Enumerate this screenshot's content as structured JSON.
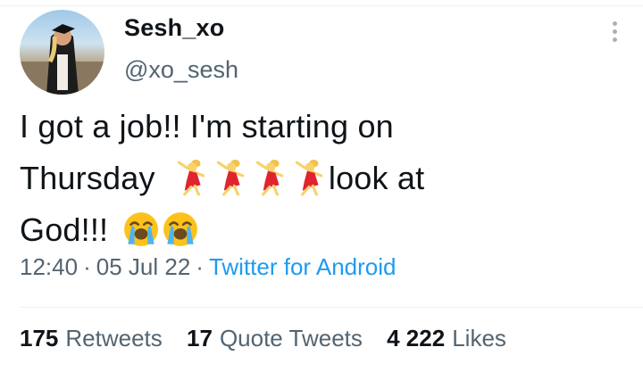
{
  "user": {
    "display_name": "Sesh_xo",
    "handle": "@xo_sesh"
  },
  "tweet": {
    "text_line1": "I got a job!! I'm starting on",
    "text_line2_before": "Thursday",
    "text_line2_after": "look at",
    "text_line3": "God!!!",
    "emojis": [
      "woman-dancing-emoji",
      "loudly-crying-face-emoji"
    ]
  },
  "meta": {
    "time": "12:40",
    "separator": "·",
    "date": "05 Jul 22",
    "source": "Twitter for Android"
  },
  "stats": {
    "retweets_count": "175",
    "retweets_label": "Retweets",
    "quotes_count": "17",
    "quotes_label": "Quote Tweets",
    "likes_count": "4 222",
    "likes_label": "Likes"
  },
  "colors": {
    "link": "#1d9bf0",
    "secondary_text": "#536471",
    "primary_text": "#0f1419"
  }
}
